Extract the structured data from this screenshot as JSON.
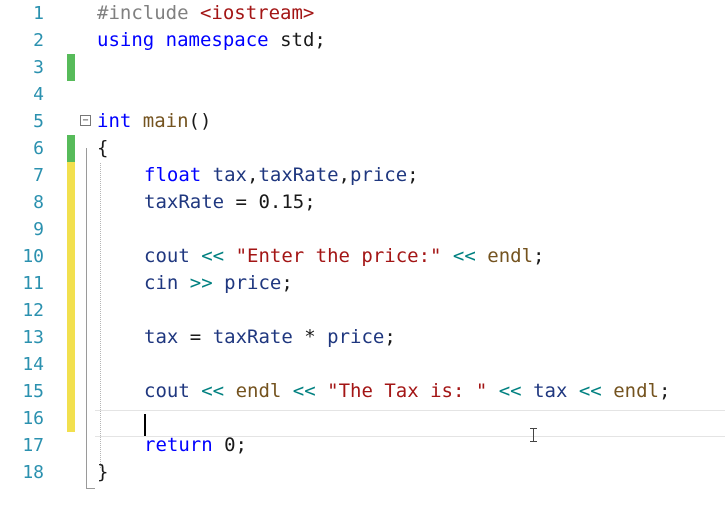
{
  "editor": {
    "lines": [
      {
        "n": "1"
      },
      {
        "n": "2"
      },
      {
        "n": "3"
      },
      {
        "n": "4"
      },
      {
        "n": "5"
      },
      {
        "n": "6"
      },
      {
        "n": "7"
      },
      {
        "n": "8"
      },
      {
        "n": "9"
      },
      {
        "n": "10"
      },
      {
        "n": "11"
      },
      {
        "n": "12"
      },
      {
        "n": "13"
      },
      {
        "n": "14"
      },
      {
        "n": "15"
      },
      {
        "n": "16"
      },
      {
        "n": "17"
      },
      {
        "n": "18"
      }
    ],
    "tokens": {
      "l1_directive": "#include",
      "l1_header": "<iostream>",
      "l2_using": "using",
      "l2_namespace": "namespace",
      "l2_std": "std;",
      "l5_int": "int",
      "l5_main": "main",
      "l5_parens": "()",
      "l6_open_brace": "{",
      "l7_float": "float",
      "l7_tax": "tax",
      "l7_comma1": ",",
      "l7_taxRate": "taxRate",
      "l7_comma2": ",",
      "l7_price": "price",
      "l7_semi": ";",
      "l8_taxRate": "taxRate",
      "l8_eq": "=",
      "l8_value": "0.15",
      "l8_semi": ";",
      "l10_cout": "cout",
      "l10_op1": "<<",
      "l10_str": "\"Enter the price:\"",
      "l10_op2": "<<",
      "l10_endl": "endl",
      "l10_semi": ";",
      "l11_cin": "cin",
      "l11_op": ">>",
      "l11_price": "price",
      "l11_semi": ";",
      "l13_tax": "tax",
      "l13_eq": "=",
      "l13_taxRate": "taxRate",
      "l13_mul": "*",
      "l13_price": "price",
      "l13_semi": ";",
      "l15_cout": "cout",
      "l15_op1": "<<",
      "l15_endl1": "endl",
      "l15_op2": "<<",
      "l15_str": "\"The Tax is: \"",
      "l15_op3": "<<",
      "l15_tax": "tax",
      "l15_op4": "<<",
      "l15_endl2": "endl",
      "l15_semi": ";",
      "l17_return": "return",
      "l17_zero": "0",
      "l17_semi": ";",
      "l18_close_brace": "}"
    },
    "fold_glyph": "−",
    "colors": {
      "line_number": "#2b91af",
      "keyword": "#0000ff",
      "string": "#a31515",
      "function": "#74531f",
      "variable": "#1f377f",
      "operator": "#008080",
      "change_saved": "#57bb5a",
      "change_unsaved": "#f2e04e"
    }
  }
}
